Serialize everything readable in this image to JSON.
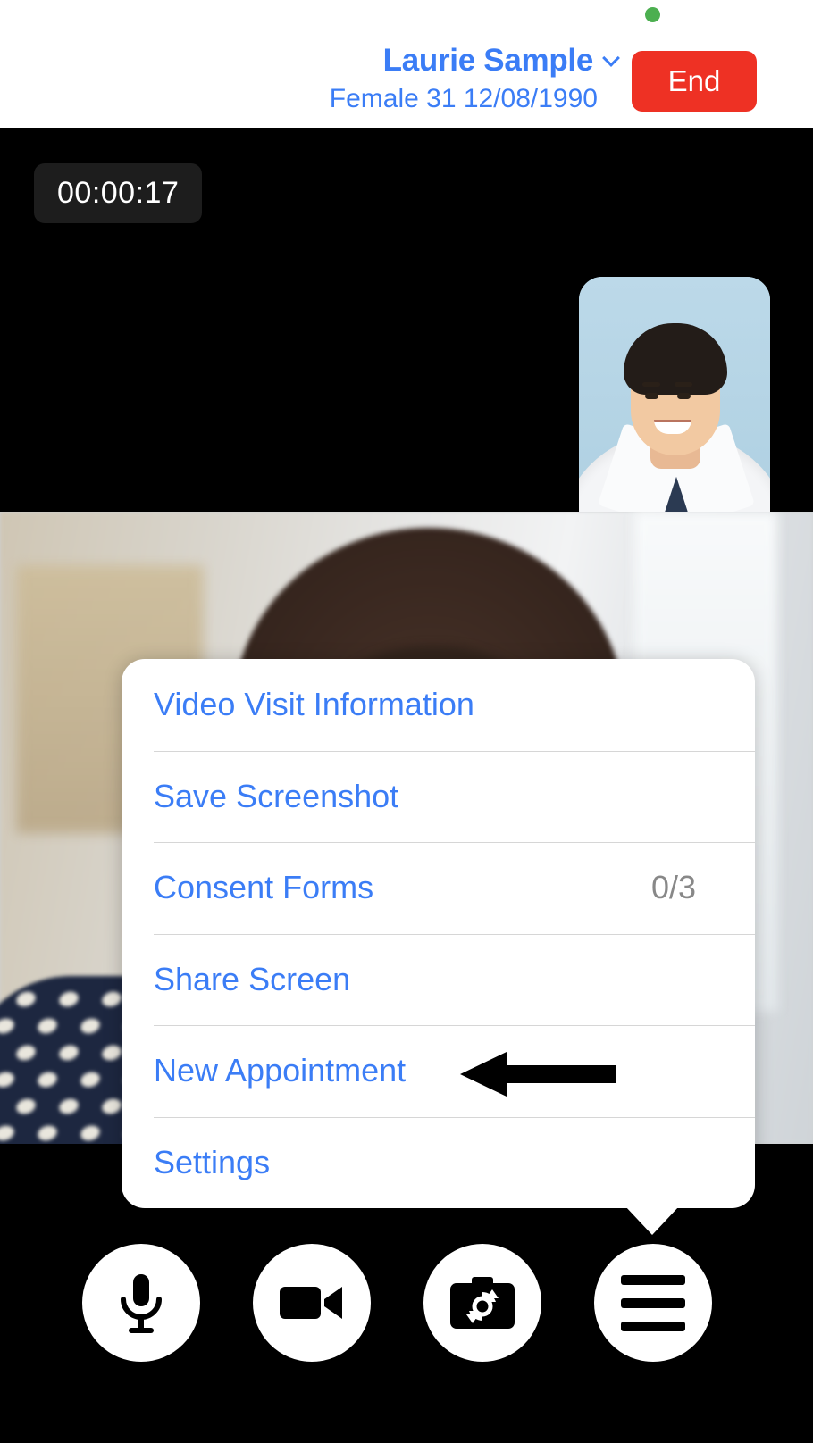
{
  "header": {
    "status_indicator": "online-dot",
    "status_color": "#4CAF50",
    "patient_name": "Laurie Sample",
    "patient_meta": "Female 31 12/08/1990",
    "chevron_icon": "chevron-down-icon",
    "end_label": "End",
    "end_color": "#EE3124",
    "accent_color": "#3B7DF6"
  },
  "remote_video": {
    "call_timer": "00:00:17",
    "self_view_label": "doctor-self-view"
  },
  "menu": {
    "items": [
      {
        "label": "Video Visit Information",
        "badge": ""
      },
      {
        "label": "Save Screenshot",
        "badge": ""
      },
      {
        "label": "Consent Forms",
        "badge": "0/3"
      },
      {
        "label": "Share Screen",
        "badge": ""
      },
      {
        "label": "New Appointment",
        "badge": ""
      },
      {
        "label": "Settings",
        "badge": ""
      }
    ],
    "badge_color": "#888888"
  },
  "annotation": {
    "type": "arrow-left",
    "points_to": "New Appointment",
    "color": "#000000"
  },
  "toolbar": {
    "buttons": [
      {
        "name": "microphone-button",
        "icon": "microphone-icon"
      },
      {
        "name": "camera-button",
        "icon": "video-camera-icon"
      },
      {
        "name": "flip-camera-button",
        "icon": "camera-flip-icon"
      },
      {
        "name": "menu-button",
        "icon": "hamburger-menu-icon"
      }
    ]
  }
}
